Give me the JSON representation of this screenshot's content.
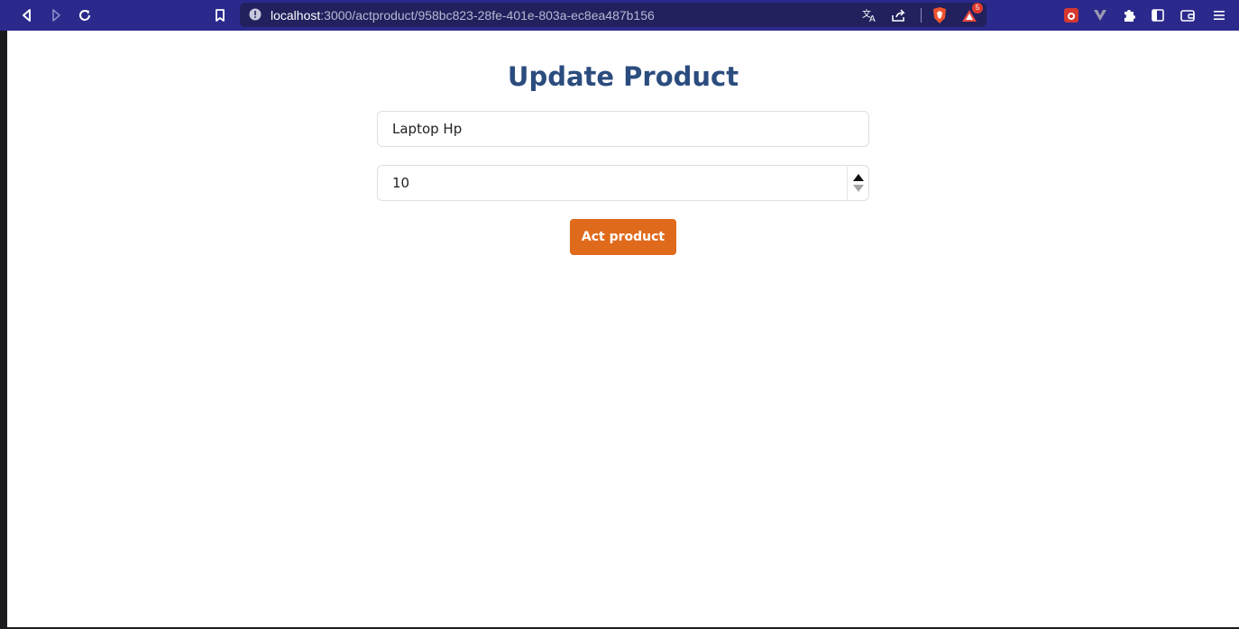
{
  "browser": {
    "url_host": "localhost",
    "url_path": ":3000/actproduct/958bc823-28fe-401e-803a-ec8ea487b156",
    "shields_badge": "5",
    "accent": "#2b2a8c"
  },
  "icons": [
    "back-icon",
    "forward-icon",
    "reload-icon",
    "bookmark-icon",
    "site-info-icon",
    "translate-icon",
    "share-icon",
    "brave-shields-icon",
    "brave-rewards-icon",
    "extension-red-icon",
    "vpn-icon",
    "extensions-puzzle-icon",
    "sidebar-icon",
    "wallet-icon",
    "menu-icon"
  ],
  "form": {
    "title": "Update Product",
    "name_value": "Laptop Hp",
    "quantity_value": "10",
    "submit_label": "Act product",
    "title_color": "#2b4c7e",
    "button_color": "#e06a1c"
  }
}
